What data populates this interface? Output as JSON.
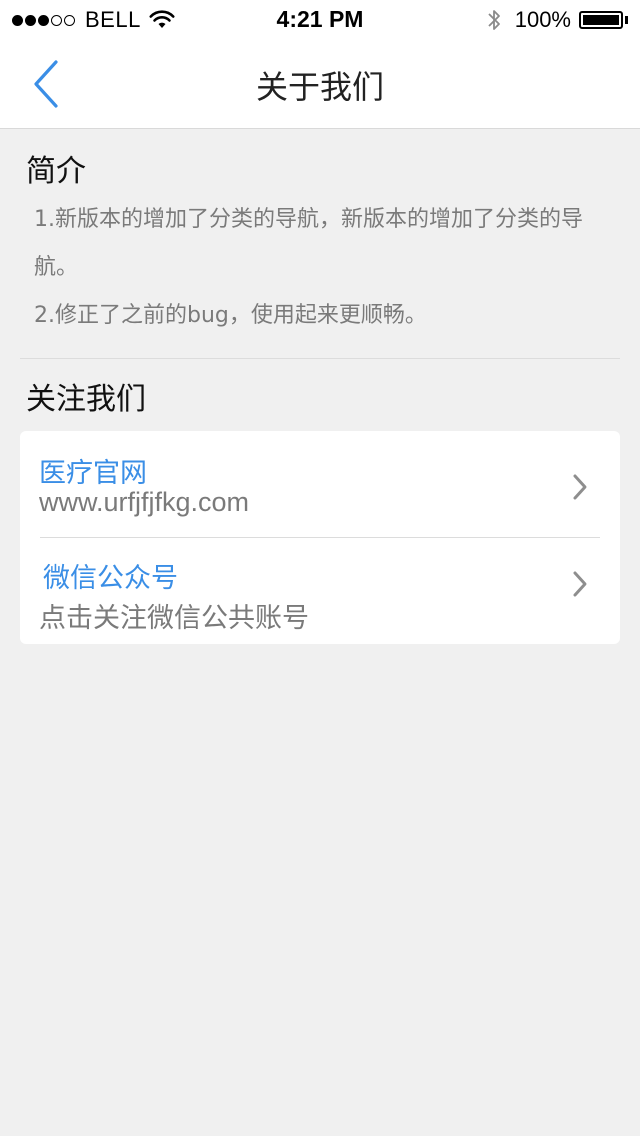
{
  "status_bar": {
    "carrier": "BELL",
    "time": "4:21 PM",
    "battery": "100%",
    "signal_strength": 3,
    "signal_max": 5,
    "battery_level": 1.0
  },
  "nav": {
    "title": "关于我们",
    "back_icon": "chevron-left-icon"
  },
  "intro": {
    "title": "简介",
    "line1": "1.新版本的增加了分类的导航，新版本的增加了分类的导航。",
    "line2": "2.修正了之前的bug，使用起来更顺畅。"
  },
  "follow": {
    "title": "关注我们",
    "items": [
      {
        "title": "医疗官网",
        "subtitle": "www.urfjfjfkg.com",
        "icon": "chevron-right-icon"
      },
      {
        "title": "微信公众号",
        "subtitle": "点击关注微信公共账号",
        "icon": "chevron-right-icon"
      }
    ]
  },
  "colors": {
    "accent": "#3a8ee6",
    "background": "#f0f0f0",
    "secondary_text": "#7a7a7a",
    "chevron": "#8e8e8e"
  }
}
